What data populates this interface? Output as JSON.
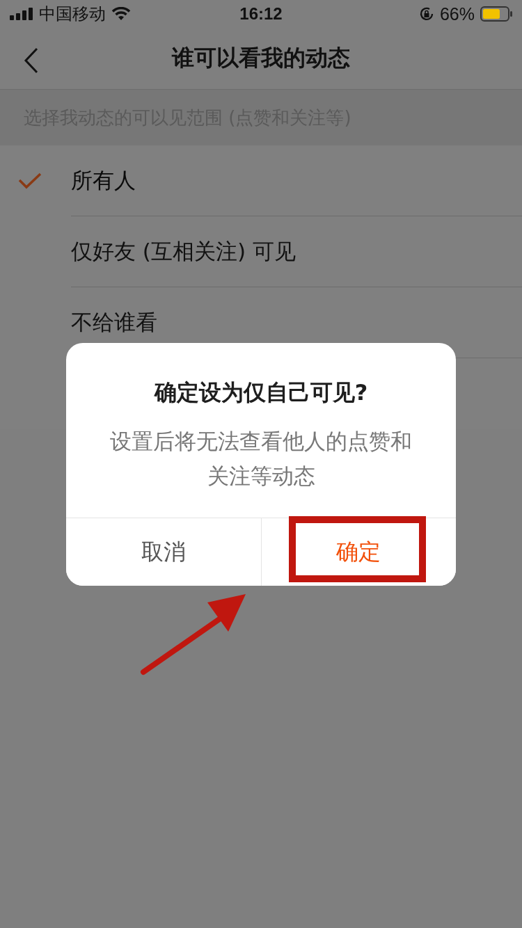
{
  "status_bar": {
    "carrier": "中国移动",
    "time": "16:12",
    "battery": "66%"
  },
  "nav": {
    "title": "谁可以看我的动态"
  },
  "section_header": "选择我动态的可以见范围 (点赞和关注等)",
  "options": [
    {
      "label": "所有人",
      "selected": true
    },
    {
      "label": "仅好友 (互相关注) 可见",
      "selected": false
    },
    {
      "label": "不给谁看",
      "selected": false
    }
  ],
  "dialog": {
    "title": "确定设为仅自己可见?",
    "message": "设置后将无法查看他人的点赞和关注等动态",
    "buttons": [
      {
        "label": "取消",
        "kind": "cancel"
      },
      {
        "label": "确定",
        "kind": "confirm"
      }
    ]
  }
}
